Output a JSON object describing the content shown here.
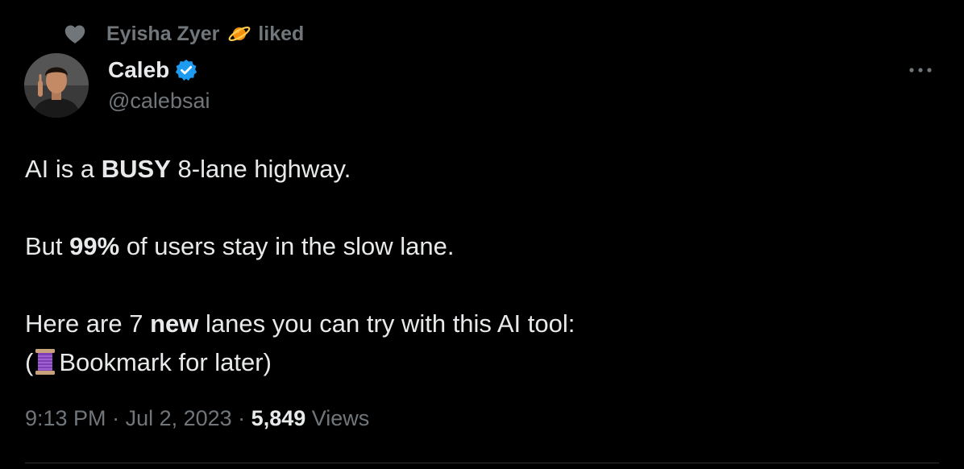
{
  "social_context": {
    "user_name": "Eyisha Zyer",
    "action": "liked"
  },
  "author": {
    "display_name": "Caleb",
    "handle": "@calebsai"
  },
  "tweet": {
    "line1_pre": "AI is a ",
    "line1_bold": "BUSY",
    "line1_post": " 8-lane highway.",
    "line2_pre": "But ",
    "line2_bold": "99%",
    "line2_post": " of users stay in the slow lane.",
    "line3_pre": "Here are 7 ",
    "line3_bold": "new",
    "line3_post": " lanes you can try with this AI tool:",
    "line4_open": "(",
    "line4_text": "Bookmark for later)"
  },
  "meta": {
    "time": "9:13 PM",
    "separator": " · ",
    "date": "Jul 2, 2023",
    "views_count": "5,849",
    "views_label": " Views"
  },
  "icons": {
    "heart": "heart-icon",
    "planet": "ringed-planet-icon",
    "verified": "verified-badge-icon",
    "more": "more-options-icon",
    "spool": "thread-spool-icon"
  },
  "colors": {
    "background": "#000000",
    "primary_text": "#e7e9ea",
    "secondary_text": "#71767b",
    "verified_blue": "#1d9bf0",
    "divider": "#2f3336"
  }
}
